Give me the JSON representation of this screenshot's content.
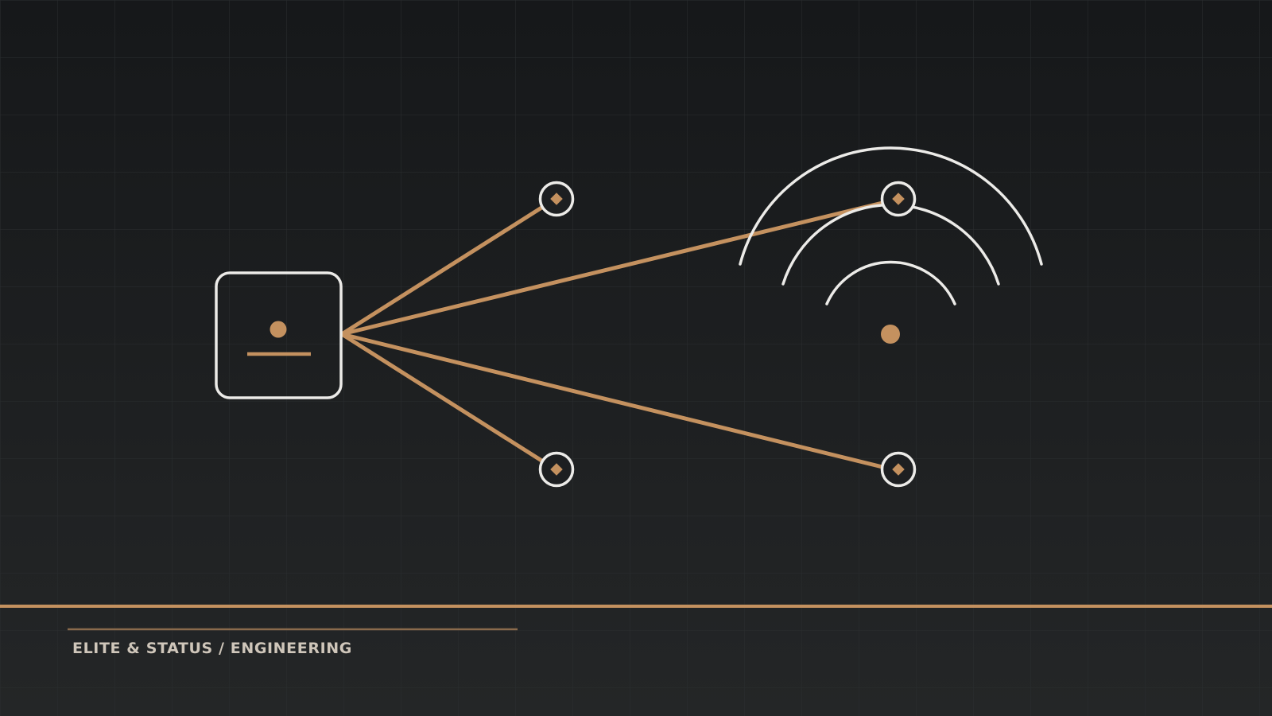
{
  "footer": {
    "label": "ELITE & STATUS / ENGINEERING"
  },
  "diagram": {
    "hub": {
      "icon": "device-hub-icon"
    },
    "nodes": [
      {
        "id": "node-top-near",
        "icon": "endpoint-node-icon"
      },
      {
        "id": "node-top-far",
        "icon": "endpoint-node-icon"
      },
      {
        "id": "node-bottom-near",
        "icon": "endpoint-node-icon"
      },
      {
        "id": "node-bottom-far",
        "icon": "endpoint-node-icon"
      }
    ],
    "broadcast": {
      "icon": "wireless-signal-icon"
    }
  },
  "colors": {
    "background_top": "#16181a",
    "background_bottom": "#232526",
    "grid": "#2b2e30",
    "accent": "#c4915f",
    "outline": "#ecebe8",
    "footer_text": "#cfc6ba"
  }
}
